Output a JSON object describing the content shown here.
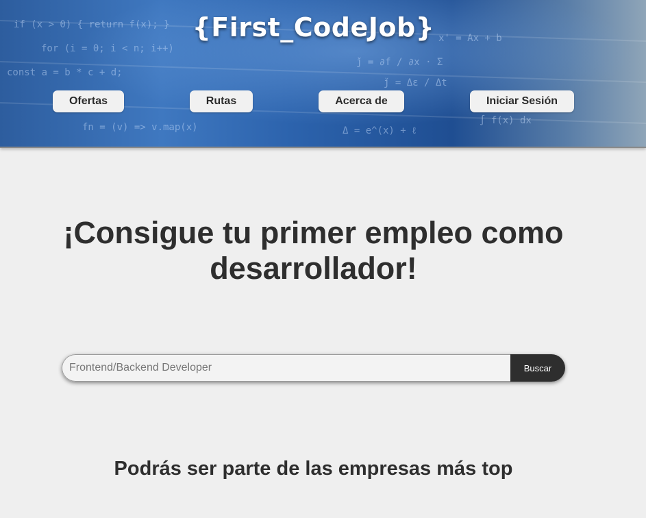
{
  "header": {
    "logo_text": "{First_CodeJob}",
    "nav": {
      "ofertas": "Ofertas",
      "rutas": "Rutas",
      "acerca": "Acerca de",
      "login": "Iniciar Sesión"
    }
  },
  "hero": {
    "title": "¡Consigue tu primer empleo como desarrollador!"
  },
  "search": {
    "placeholder": "Frontend/Backend Developer",
    "value": "",
    "button_label": "Buscar"
  },
  "companies": {
    "title": "Podrás ser parte de las empresas más top"
  },
  "colors": {
    "page_background": "#efefef",
    "text": "#2e2e2e",
    "search_button": "#2e2e2e",
    "nav_button": "#f1f1f1",
    "header_blue": "#2c63ad"
  }
}
